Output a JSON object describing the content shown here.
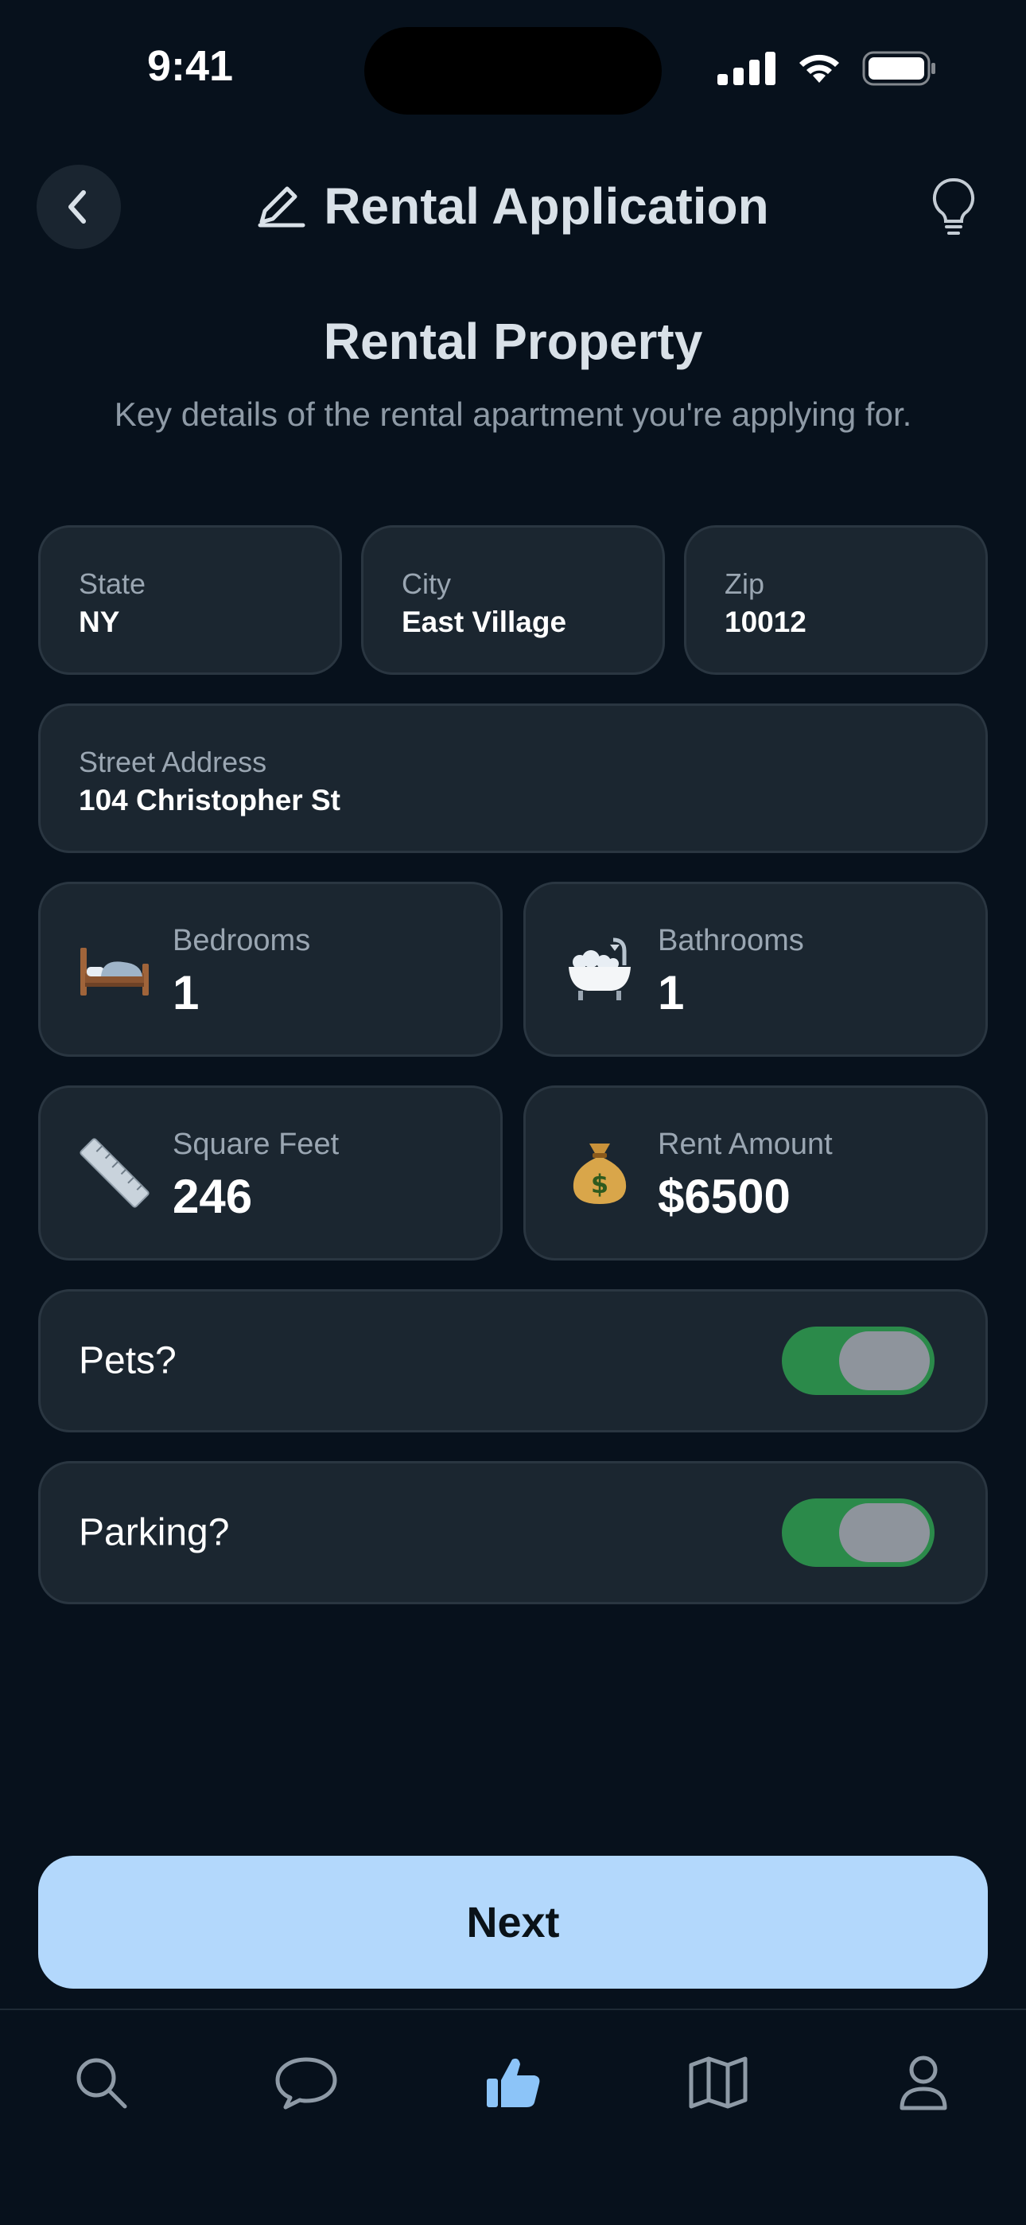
{
  "status_bar": {
    "time": "9:41"
  },
  "header": {
    "title": "Rental Application"
  },
  "section": {
    "title": "Rental Property",
    "subtitle": "Key details of the rental apartment you're applying for."
  },
  "fields": {
    "state": {
      "label": "State",
      "value": "NY"
    },
    "city": {
      "label": "City",
      "value": "East Village"
    },
    "zip": {
      "label": "Zip",
      "value": "10012"
    },
    "street": {
      "label": "Street Address",
      "value": "104 Christopher St"
    }
  },
  "stats": {
    "bedrooms": {
      "label": "Bedrooms",
      "value": "1",
      "icon": "bed-icon"
    },
    "bathrooms": {
      "label": "Bathrooms",
      "value": "1",
      "icon": "bathtub-icon"
    },
    "sqft": {
      "label": "Square Feet",
      "value": "246",
      "icon": "ruler-icon"
    },
    "rent": {
      "label": "Rent Amount",
      "value": "$6500",
      "icon": "money-bag-icon"
    }
  },
  "toggles": {
    "pets": {
      "label": "Pets?",
      "on": true
    },
    "parking": {
      "label": "Parking?",
      "on": true
    }
  },
  "next_button": {
    "label": "Next"
  },
  "tabbar": {
    "items": [
      "search-icon",
      "chat-icon",
      "thumbs-up-icon",
      "map-icon",
      "profile-icon"
    ],
    "active": "thumbs-up-icon",
    "active_color": "#8cc4f8",
    "inactive_color": "#8e9aa6"
  },
  "colors": {
    "background": "#07111c",
    "card": "#1b2630",
    "accent": "#b3d8fc",
    "toggle_on": "#2b8a4a"
  }
}
